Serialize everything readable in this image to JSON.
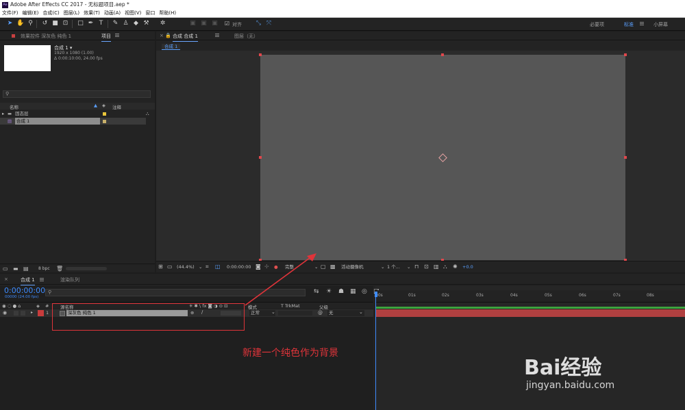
{
  "window": {
    "logo": "Ae",
    "title": "Adobe After Effects CC 2017 - 无标题项目.aep *"
  },
  "menu": [
    "文件(F)",
    "编辑(E)",
    "合成(C)",
    "图层(L)",
    "效果(T)",
    "动画(A)",
    "视图(V)",
    "窗口",
    "帮助(H)"
  ],
  "toolbar": {
    "snap_label": "对齐",
    "workspaces": [
      "必要项",
      "标准",
      "小屏幕"
    ]
  },
  "project": {
    "tabs": [
      "效果控件 深灰色 纯色 1",
      "项目"
    ],
    "comp_name": "合成 1 ▾",
    "comp_size": "1920 x 1080 (1.00)",
    "comp_duration": "Δ 0:00:10:00, 24.00 fps",
    "columns": {
      "name": "名称",
      "comment": "注释"
    },
    "items": [
      {
        "name": "固态层",
        "type": "folder",
        "label_color": "#e8c43a"
      },
      {
        "name": "合成 1",
        "type": "comp",
        "label_color": "#c8b06a"
      }
    ],
    "bpc": "8 bpc"
  },
  "viewer": {
    "tabs": [
      "合成 合成 1",
      "图层（无）"
    ],
    "breadcrumb": "合成 1",
    "zoom": "(44.4%)",
    "timecode": "0:00:00:00",
    "resolution": "完整",
    "camera": "活动摄像机",
    "views": "1 个...",
    "exposure": "+0.0"
  },
  "timeline": {
    "tabs": [
      "合成 1",
      "渲染队列"
    ],
    "current_time": "0:00:00:00",
    "frame_info": "00000 (24.00 fps)",
    "columns": {
      "source": "源名称",
      "mode": "模式",
      "trkmat": "T  TrkMat",
      "parent": "父级"
    },
    "ruler": [
      "00s",
      "01s",
      "02s",
      "03s",
      "04s",
      "05s",
      "06s",
      "07s",
      "08s"
    ],
    "layers": [
      {
        "index": "1",
        "name": "深灰色 纯色 1",
        "mode": "正常",
        "parent": "无",
        "label_color": "#c83c3c"
      }
    ]
  },
  "annotation": "新建一个纯色作为背景",
  "watermark": {
    "brand": "Bai经验",
    "url": "jingyan.baidu.com"
  }
}
